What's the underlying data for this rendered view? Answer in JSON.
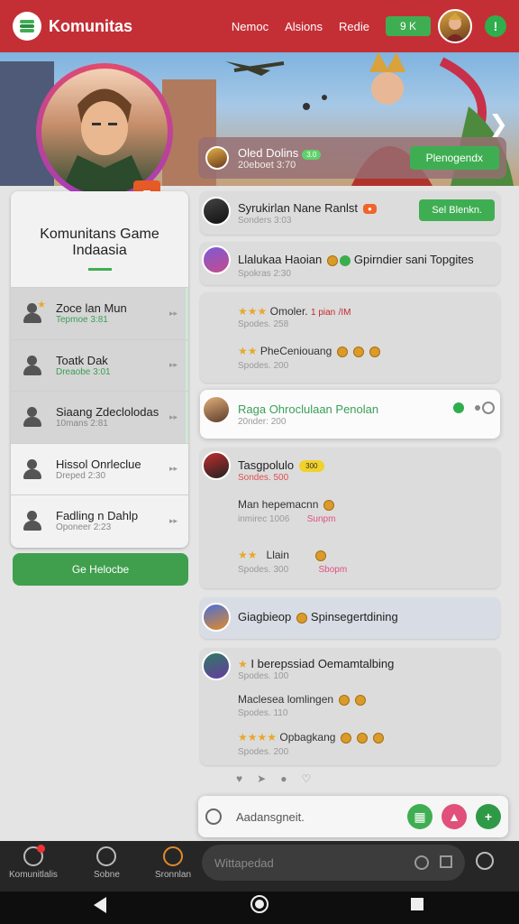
{
  "header": {
    "app_title": "Komunitas",
    "nav": [
      "Nemoc",
      "Alsions",
      "Redie"
    ],
    "notif_label": "9 K",
    "status_label": "!"
  },
  "banner": {
    "event_title": "Oled Dolins",
    "event_pill": "3.0",
    "event_sub": "20eboet 3:70",
    "event_button": "Plenogendx"
  },
  "community": {
    "title_line1": "Komunitans Game",
    "title_line2": "Indaasia",
    "members": [
      {
        "name": "Zoce lan Mun",
        "sub": "Tepmoe 3:81"
      },
      {
        "name": "Toatk Dak",
        "sub": "Dreaobe 3:01"
      },
      {
        "name": "Siaang Zdeclolodas",
        "sub": "10mans 2:81"
      },
      {
        "name": "Hissol Onrleclue",
        "sub": "Dreped 2:30"
      },
      {
        "name": "Fadling n Dahlp",
        "sub": "Oponeer 2:23"
      }
    ],
    "button": "Ge Helocbe"
  },
  "feed": {
    "post1": {
      "title": "Syrukirlan Nane Ranlst",
      "sub": "Sonders 3:03",
      "button": "Sel Blenkn."
    },
    "post2": {
      "title": "Llalukaa Haoian",
      "title2": "Gpirndier  sani Topgites",
      "sub": "Spokras 2:30"
    },
    "post3": {
      "line1": "Omoler.",
      "line1_tag": "1 pian",
      "line1_tag2": "/IM",
      "sub1": "Spodes. 258",
      "line2": "PheCeniouang",
      "sub2": "Spodes. 200"
    },
    "post4": {
      "title": "Raga Ohroclulaan Penolan",
      "sub": "20nder: 200"
    },
    "post5": {
      "title": "Tasgpolulo",
      "title_tag": "300",
      "sub": "Sondes. 500",
      "line2": "Man hepemacnn",
      "sub2": "inmirec 1006",
      "sub2b": "Sunpm",
      "line3": "Llain",
      "sub3": "Spodes. 300",
      "sub3b": "Sbopm"
    },
    "post6": {
      "title": "Giagbieop",
      "title2": "Spinsegertdining"
    },
    "post7": {
      "title": "I berepssiad Oemamtalbing",
      "sub": "Spodes. 100",
      "line2": "Maclesea lomlingen",
      "sub2": "Spodes. 110",
      "line3": "Opbagkang",
      "sub3": "Spodes. 200"
    }
  },
  "composer": {
    "placeholder": "Aadansgneit."
  },
  "bottom_nav": {
    "items": [
      "Komunitlalis",
      "Sobne",
      "Sronnlan"
    ],
    "search_placeholder": "Wittapedad"
  }
}
